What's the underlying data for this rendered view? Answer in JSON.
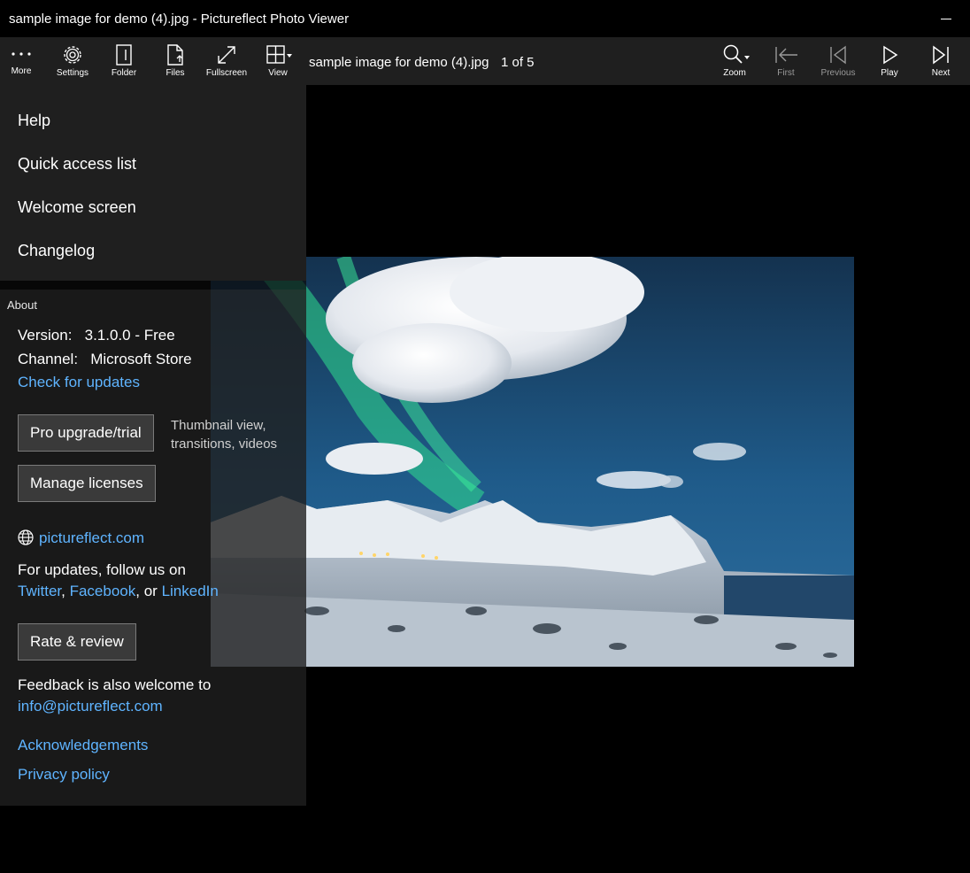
{
  "window": {
    "title": "sample image for demo (4).jpg - Pictureflect Photo Viewer"
  },
  "toolbar": {
    "more": "More",
    "settings": "Settings",
    "folder": "Folder",
    "files": "Files",
    "fullscreen": "Fullscreen",
    "view": "View",
    "filename": "sample image for demo (4).jpg",
    "counter": "1 of 5",
    "zoom": "Zoom",
    "first": "First",
    "previous": "Previous",
    "play": "Play",
    "next": "Next"
  },
  "menu": {
    "items": [
      "Help",
      "Quick access list",
      "Welcome screen",
      "Changelog"
    ]
  },
  "about": {
    "header": "About",
    "version_label": "Version:",
    "version_value": "3.1.0.0 - Free",
    "channel_label": "Channel:",
    "channel_value": "Microsoft Store",
    "check_updates": "Check for updates",
    "pro_button": "Pro upgrade/trial",
    "pro_note_1": "Thumbnail view,",
    "pro_note_2": "transitions, videos",
    "licenses_button": "Manage licenses",
    "website": "pictureflect.com",
    "follow_text": "For updates, follow us on",
    "twitter": "Twitter",
    "comma": ",",
    "facebook": "Facebook",
    "or": ", or",
    "linkedin": "LinkedIn",
    "rate_button": "Rate & review",
    "feedback_text": "Feedback is also welcome to",
    "email": "info@pictureflect.com",
    "acknowledgements": "Acknowledgements",
    "privacy": "Privacy policy"
  },
  "colors": {
    "link": "#5fb4ff",
    "panel": "#1f1f1f"
  }
}
